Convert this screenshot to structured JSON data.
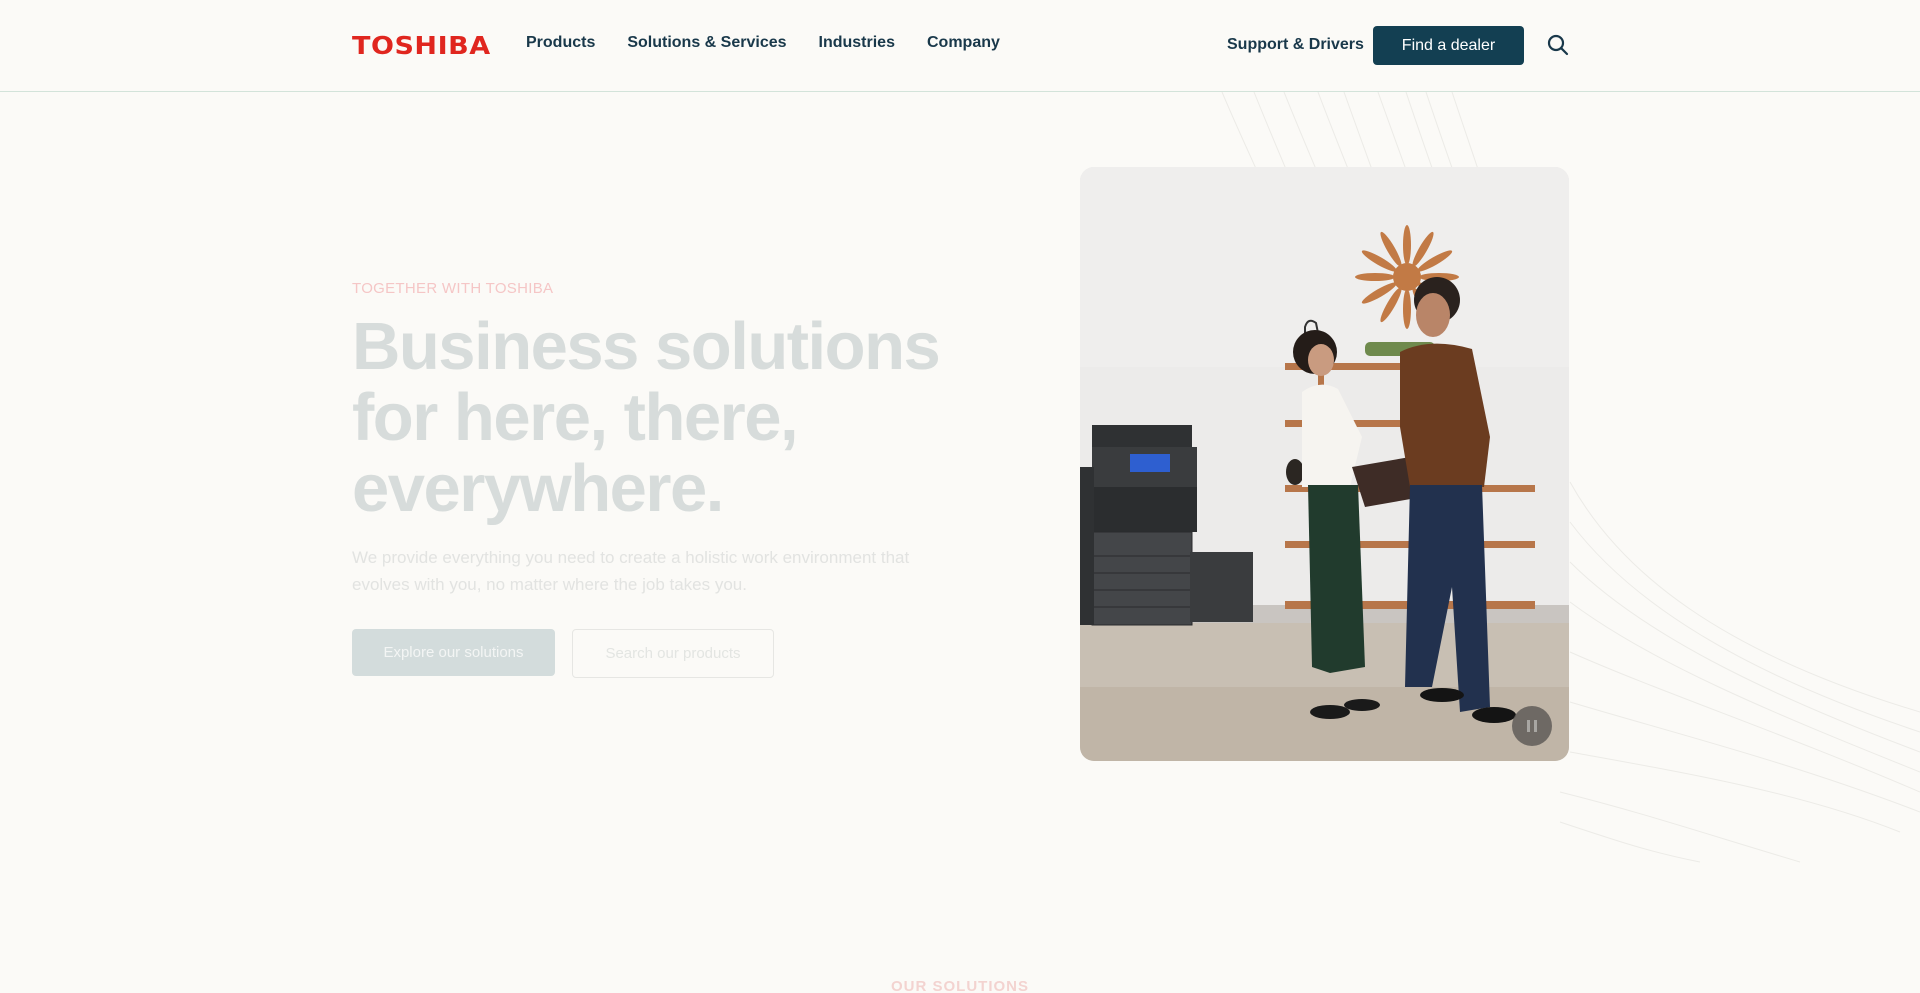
{
  "header": {
    "logo": "TOSHIBA",
    "nav": [
      {
        "label": "Products"
      },
      {
        "label": "Solutions & Services"
      },
      {
        "label": "Industries"
      },
      {
        "label": "Company"
      }
    ],
    "support_label": "Support & Drivers",
    "dealer_button": "Find a dealer",
    "search_icon": "search-icon"
  },
  "hero": {
    "eyebrow": "TOGETHER WITH TOSHIBA",
    "headline_lines": [
      "Business solutions",
      "for here, there,",
      "everywhere."
    ],
    "subtext": "We provide everything you need to create a holistic work environment that evolves with you, no matter where the job takes you.",
    "primary_button": "Explore our solutions",
    "secondary_button": "Search our products",
    "image_alt": "Two colleagues reviewing a folder next to a Toshiba multifunction printer in an office",
    "pause_icon": "pause-icon"
  },
  "next_section": {
    "label": "OUR SOLUTIONS"
  },
  "colors": {
    "brand_red": "#e0261f",
    "navy": "#133f52",
    "nav_text": "#19384a",
    "background": "#fbfaf7"
  }
}
